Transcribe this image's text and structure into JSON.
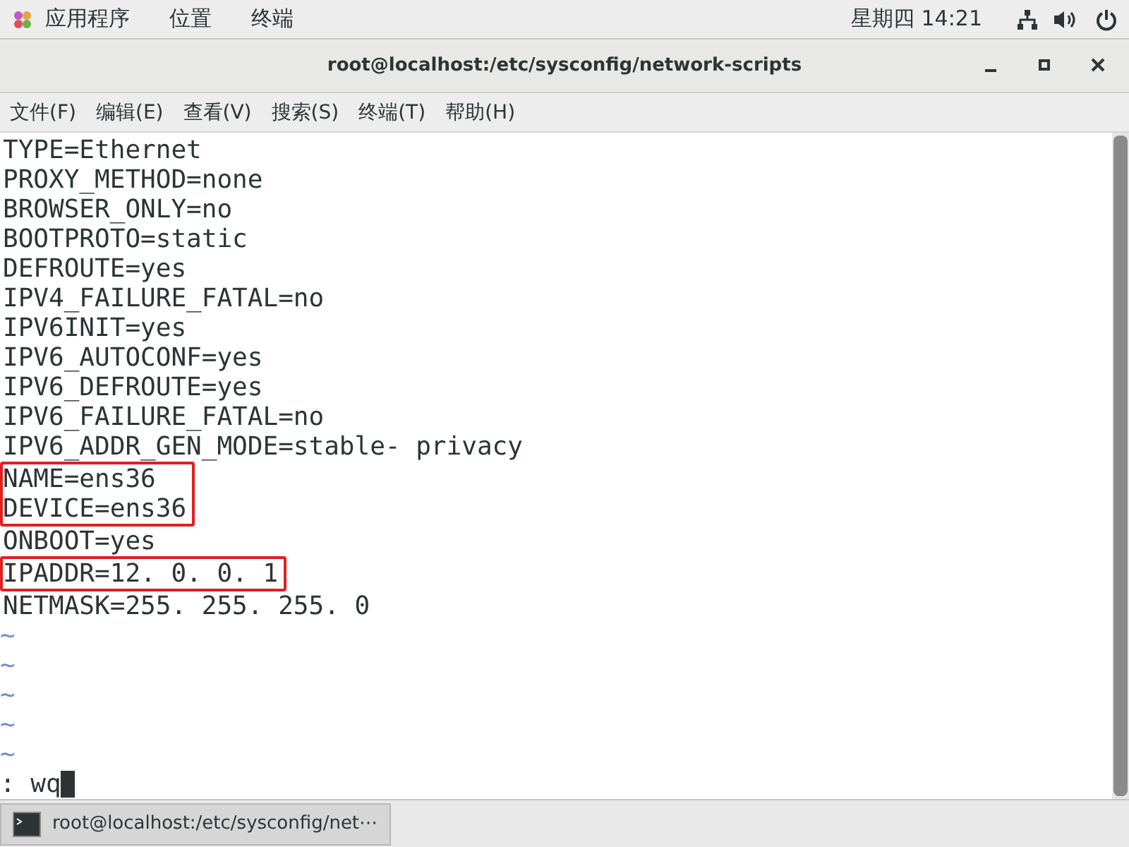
{
  "top_bar": {
    "menus": [
      "应用程序",
      "位置",
      "终端"
    ],
    "clock": "星期四 14:21"
  },
  "window": {
    "title": "root@localhost:/etc/sysconfig/network-scripts"
  },
  "menu_bar": [
    "文件(F)",
    "编辑(E)",
    "查看(V)",
    "搜索(S)",
    "终端(T)",
    "帮助(H)"
  ],
  "editor": {
    "blocks": [
      {
        "highlighted": false,
        "lines": [
          "TYPE=Ethernet",
          "PROXY_METHOD=none",
          "BROWSER_ONLY=no",
          "BOOTPROTO=static",
          "DEFROUTE=yes",
          "IPV4_FAILURE_FATAL=no",
          "IPV6INIT=yes",
          "IPV6_AUTOCONF=yes",
          "IPV6_DEFROUTE=yes",
          "IPV6_FAILURE_FATAL=no",
          "IPV6_ADDR_GEN_MODE=stable- privacy"
        ]
      },
      {
        "highlighted": true,
        "lines": [
          "NAME=ens36",
          "DEVICE=ens36"
        ]
      },
      {
        "highlighted": false,
        "lines": [
          "ONBOOT=yes"
        ]
      },
      {
        "highlighted": true,
        "lines": [
          "IPADDR=12. 0. 0. 1"
        ]
      },
      {
        "highlighted": false,
        "lines": [
          "NETMASK=255. 255. 255. 0"
        ]
      }
    ],
    "tildes": [
      "~",
      "~",
      "~",
      "~",
      "~"
    ],
    "command": ": wq"
  },
  "taskbar": {
    "items": [
      {
        "label": "root@localhost:/etc/sysconfig/net⋯",
        "selected": true
      }
    ]
  }
}
